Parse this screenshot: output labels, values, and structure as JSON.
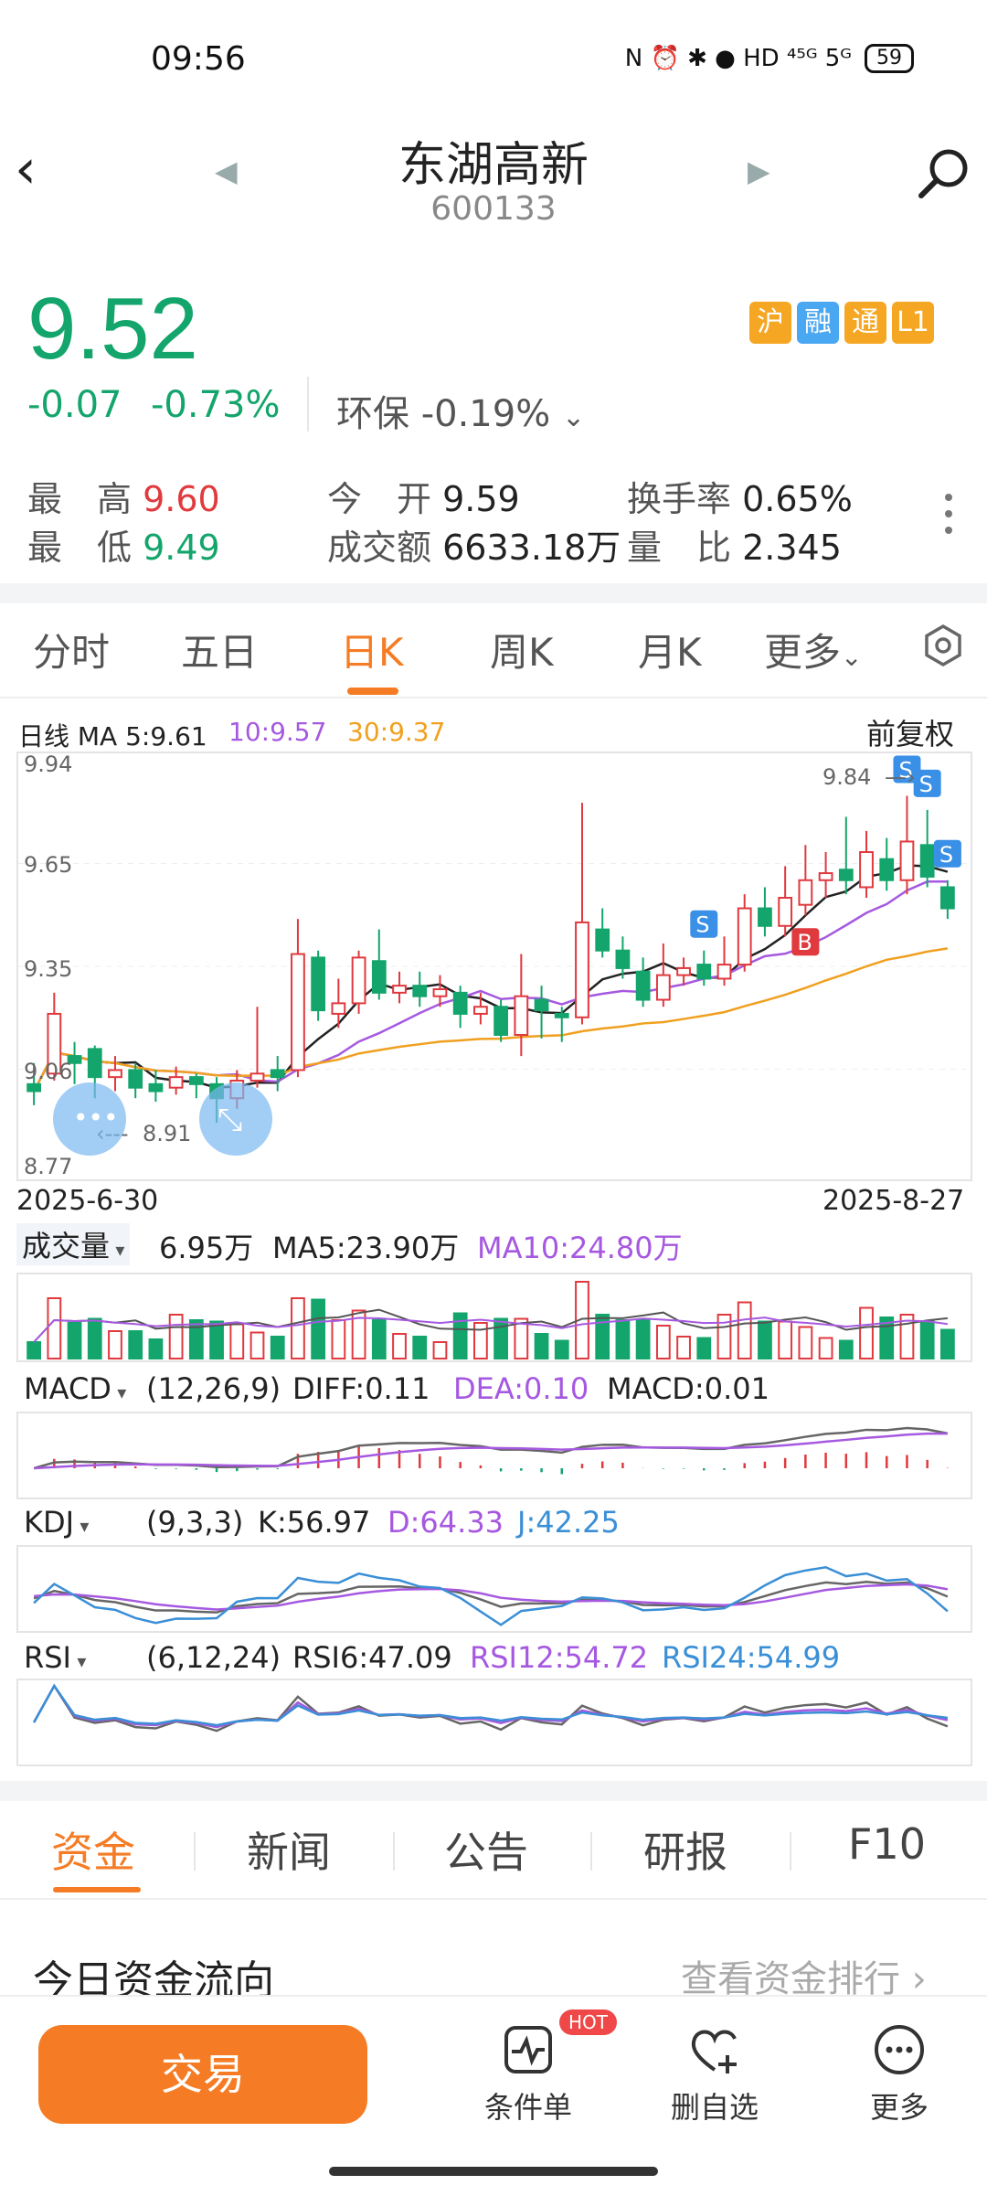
{
  "status_bar": {
    "time": "09:56",
    "icons": "N ⏰ ✱ ● HD ⁴⁵ᴳ 5ᴳ",
    "battery": "59"
  },
  "header": {
    "name": "东湖高新",
    "code": "600133"
  },
  "quote": {
    "price": "9.52",
    "change": "-0.07",
    "change_pct": "-0.73%",
    "sector": "环保 -0.19%",
    "badges": [
      {
        "text": "沪",
        "color": "#f5a623"
      },
      {
        "text": "融",
        "color": "#4aa7f2"
      },
      {
        "text": "通",
        "color": "#f5a623"
      },
      {
        "text": "L1",
        "color": "#f5a623"
      }
    ]
  },
  "stats": {
    "high_label": "最　高",
    "high": "9.60",
    "low_label": "最　低",
    "low": "9.49",
    "open_label": "今　开",
    "open": "9.59",
    "amount_label": "成交额",
    "amount": "6633.18万",
    "turnover_label": "换手率",
    "turnover": "0.65%",
    "vol_ratio_label": "量　比",
    "vol_ratio": "2.345"
  },
  "tabs": {
    "items": [
      "分时",
      "五日",
      "日K",
      "周K",
      "月K",
      "更多"
    ],
    "active": "日K"
  },
  "chart_info": {
    "ma_label": "日线 MA 5:9.61",
    "ma10": "10:9.57",
    "ma30": "30:9.37",
    "adjust": "前复权"
  },
  "chart_data": {
    "type": "candlestick",
    "y_ticks": [
      "9.94",
      "9.65",
      "9.35",
      "9.06",
      "8.77"
    ],
    "ylim": [
      8.77,
      9.94
    ],
    "start_date": "2025-6-30",
    "end_date": "2025-8-27",
    "max_label": "9.84",
    "min_label": "8.91",
    "markers": [
      "S",
      "S",
      "S",
      "S",
      "B"
    ],
    "candles": [
      [
        9.02,
        9.0,
        9.08,
        8.96
      ],
      [
        9.05,
        9.22,
        9.28,
        9.03
      ],
      [
        9.1,
        9.08,
        9.14,
        9.02
      ],
      [
        9.12,
        9.04,
        9.13,
        8.98
      ],
      [
        9.04,
        9.06,
        9.1,
        9.0
      ],
      [
        9.06,
        9.01,
        9.08,
        8.98
      ],
      [
        9.02,
        9.0,
        9.06,
        8.97
      ],
      [
        9.01,
        9.04,
        9.07,
        8.99
      ],
      [
        9.04,
        9.02,
        9.05,
        8.98
      ],
      [
        9.02,
        8.98,
        9.04,
        8.91
      ],
      [
        8.98,
        9.03,
        9.06,
        8.95
      ],
      [
        9.03,
        9.05,
        9.24,
        9.01
      ],
      [
        9.06,
        9.04,
        9.1,
        9.0
      ],
      [
        9.06,
        9.39,
        9.49,
        9.04
      ],
      [
        9.38,
        9.23,
        9.4,
        9.2
      ],
      [
        9.22,
        9.25,
        9.32,
        9.18
      ],
      [
        9.25,
        9.38,
        9.4,
        9.22
      ],
      [
        9.37,
        9.28,
        9.46,
        9.26
      ],
      [
        9.28,
        9.3,
        9.34,
        9.25
      ],
      [
        9.3,
        9.27,
        9.34,
        9.24
      ],
      [
        9.27,
        9.29,
        9.33,
        9.24
      ],
      [
        9.28,
        9.22,
        9.3,
        9.18
      ],
      [
        9.22,
        9.24,
        9.28,
        9.19
      ],
      [
        9.24,
        9.16,
        9.26,
        9.14
      ],
      [
        9.16,
        9.27,
        9.39,
        9.1
      ],
      [
        9.26,
        9.23,
        9.3,
        9.15
      ],
      [
        9.22,
        9.21,
        9.24,
        9.14
      ],
      [
        9.21,
        9.48,
        9.82,
        9.19
      ],
      [
        9.46,
        9.4,
        9.52,
        9.38
      ],
      [
        9.4,
        9.35,
        9.44,
        9.32
      ],
      [
        9.34,
        9.26,
        9.38,
        9.24
      ],
      [
        9.26,
        9.33,
        9.42,
        9.24
      ],
      [
        9.33,
        9.35,
        9.38,
        9.3
      ],
      [
        9.36,
        9.32,
        9.4,
        9.3
      ],
      [
        9.32,
        9.36,
        9.44,
        9.3
      ],
      [
        9.36,
        9.52,
        9.56,
        9.34
      ],
      [
        9.52,
        9.47,
        9.58,
        9.44
      ],
      [
        9.47,
        9.55,
        9.64,
        9.44
      ],
      [
        9.53,
        9.6,
        9.7,
        9.5
      ],
      [
        9.6,
        9.62,
        9.68,
        9.55
      ],
      [
        9.63,
        9.6,
        9.78,
        9.56
      ],
      [
        9.58,
        9.68,
        9.74,
        9.55
      ],
      [
        9.66,
        9.6,
        9.72,
        9.57
      ],
      [
        9.6,
        9.71,
        9.84,
        9.56
      ],
      [
        9.7,
        9.61,
        9.8,
        9.58
      ],
      [
        9.58,
        9.52,
        9.6,
        9.49
      ]
    ]
  },
  "volume": {
    "label": "成交量",
    "value": "6.95万",
    "ma5": "MA5:23.90万",
    "ma10": "MA10:24.80万"
  },
  "macd": {
    "label": "MACD",
    "params": "(12,26,9)",
    "diff": "DIFF:0.11",
    "dea": "DEA:0.10",
    "macd": "MACD:0.01"
  },
  "kdj": {
    "label": "KDJ",
    "params": "(9,3,3)",
    "k": "K:56.97",
    "d": "D:64.33",
    "j": "J:42.25"
  },
  "rsi": {
    "label": "RSI",
    "params": "(6,12,24)",
    "rsi6": "RSI6:47.09",
    "rsi12": "RSI12:54.72",
    "rsi24": "RSI24:54.99"
  },
  "bottom_tabs": {
    "items": [
      "资金",
      "新闻",
      "公告",
      "研报",
      "F10"
    ],
    "active": "资金"
  },
  "fund_flow": {
    "title": "今日资金流向",
    "link": "查看资金排行 ›"
  },
  "bottom_bar": {
    "trade": "交易",
    "condition": "条件单",
    "hot": "HOT",
    "remove_watch": "删自选",
    "more": "更多"
  },
  "colors": {
    "up": "#e0393e",
    "down": "#13a56b",
    "accent": "#f57c24",
    "ma5": "#222222",
    "ma10": "#a659e0",
    "ma30": "#f0a020"
  }
}
